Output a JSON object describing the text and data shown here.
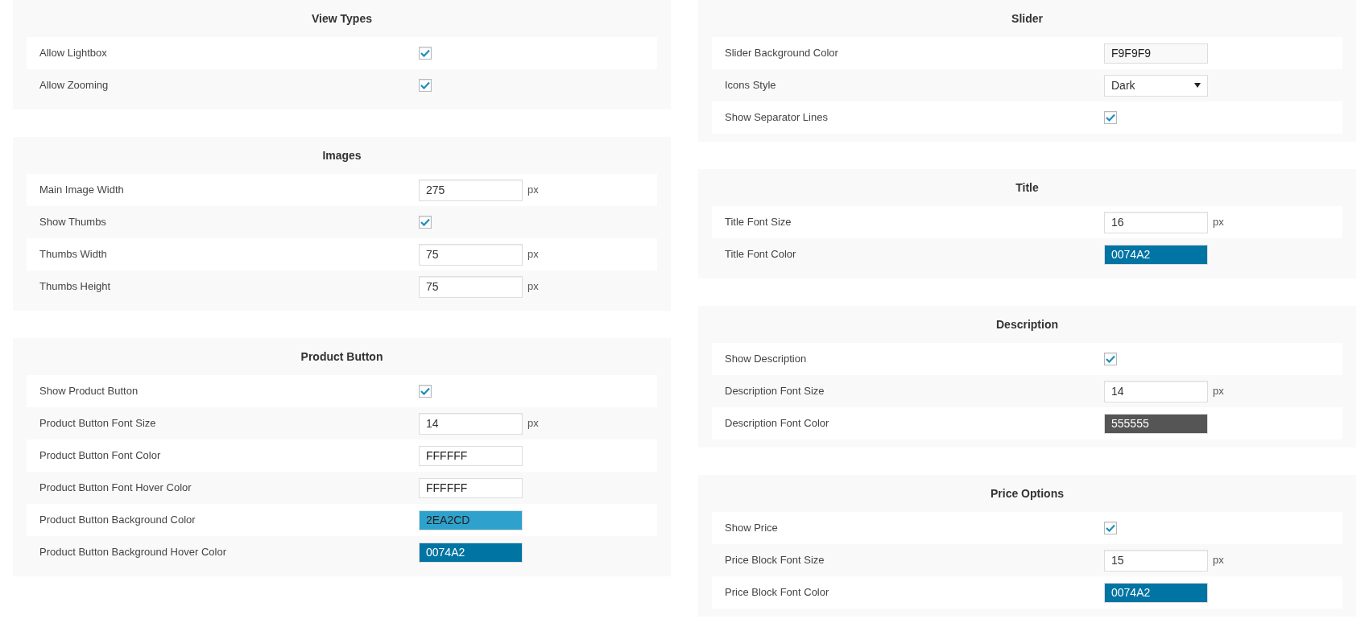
{
  "columns": [
    {
      "panels": [
        {
          "title": "View Types",
          "rows": [
            {
              "label": "Allow Lightbox",
              "kind": "checkbox",
              "checked": true
            },
            {
              "label": "Allow Zooming",
              "kind": "checkbox",
              "checked": true
            }
          ]
        },
        {
          "title": "Images",
          "rows": [
            {
              "label": "Main Image Width",
              "kind": "number",
              "value": "275",
              "unit": "px"
            },
            {
              "label": "Show Thumbs",
              "kind": "checkbox",
              "checked": true
            },
            {
              "label": "Thumbs Width",
              "kind": "number",
              "value": "75",
              "unit": "px"
            },
            {
              "label": "Thumbs Height",
              "kind": "number",
              "value": "75",
              "unit": "px"
            }
          ]
        },
        {
          "title": "Product Button",
          "rows": [
            {
              "label": "Show Product Button",
              "kind": "checkbox",
              "checked": true
            },
            {
              "label": "Product Button Font Size",
              "kind": "number",
              "value": "14",
              "unit": "px"
            },
            {
              "label": "Product Button Font Color",
              "kind": "color",
              "value": "FFFFFF"
            },
            {
              "label": "Product Button Font Hover Color",
              "kind": "color",
              "value": "FFFFFF"
            },
            {
              "label": "Product Button Background Color",
              "kind": "color",
              "value": "2EA2CD"
            },
            {
              "label": "Product Button Background Hover Color",
              "kind": "color",
              "value": "0074A2"
            }
          ]
        }
      ]
    },
    {
      "panels": [
        {
          "title": "Slider",
          "rows": [
            {
              "label": "Slider Background Color",
              "kind": "color",
              "value": "F9F9F9"
            },
            {
              "label": "Icons Style",
              "kind": "select",
              "value": "Dark"
            },
            {
              "label": "Show Separator Lines",
              "kind": "checkbox",
              "checked": true
            }
          ]
        },
        {
          "title": "Title",
          "rows": [
            {
              "label": "Title Font Size",
              "kind": "number",
              "value": "16",
              "unit": "px"
            },
            {
              "label": "Title Font Color",
              "kind": "color",
              "value": "0074A2"
            }
          ]
        },
        {
          "title": "Description",
          "rows": [
            {
              "label": "Show Description",
              "kind": "checkbox",
              "checked": true
            },
            {
              "label": "Description Font Size",
              "kind": "number",
              "value": "14",
              "unit": "px"
            },
            {
              "label": "Description Font Color",
              "kind": "color",
              "value": "555555"
            }
          ]
        },
        {
          "title": "Price Options",
          "rows": [
            {
              "label": "Show Price",
              "kind": "checkbox",
              "checked": true
            },
            {
              "label": "Price Block Font Size",
              "kind": "number",
              "value": "15",
              "unit": "px"
            },
            {
              "label": "Price Block Font Color",
              "kind": "color",
              "value": "0074A2"
            }
          ]
        }
      ]
    }
  ]
}
